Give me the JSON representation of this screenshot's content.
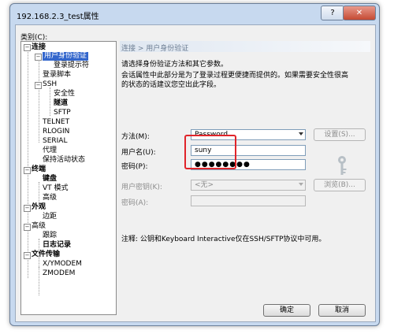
{
  "window": {
    "title": "192.168.2.3_test属性",
    "help_label": "?",
    "close_label": "✕"
  },
  "category_label": "类别(C):",
  "tree": {
    "connection": "连接",
    "auth": "用户身份验证",
    "login_prompt": "登录提示符",
    "login_script": "登录脚本",
    "ssh": "SSH",
    "security": "安全性",
    "tunnel": "隧道",
    "sftp": "SFTP",
    "telnet": "TELNET",
    "rlogin": "RLOGIN",
    "serial": "SERIAL",
    "proxy": "代理",
    "keepalive": "保持活动状态",
    "terminal": "终端",
    "keyboard": "键盘",
    "vt_mode": "VT 模式",
    "term_advanced": "高级",
    "appearance": "外观",
    "margin": "边距",
    "advanced": "高级",
    "trace": "跟踪",
    "logging": "日志记录",
    "file_transfer": "文件传输",
    "xymodem": "X/YMODEM",
    "zmodem": "ZMODEM"
  },
  "panel": {
    "header": "连接 > 用户身份验证",
    "desc1": "请选择身份验证方法和其它参数。",
    "desc2": "会话属性中此部分是为了登录过程更便捷而提供的。如果需要安全性很高",
    "desc3": "的状态的话建议您空出此字段。",
    "method_label": "方法(M):",
    "method_value": "Password",
    "settings_button": "设置(S)...",
    "username_label": "用户名(U):",
    "username_value": "suny",
    "password_label": "密码(P):",
    "password_value": "●●●●●●●●",
    "userkey_label": "用户密钥(K):",
    "userkey_value": "<无>",
    "browse_button": "浏览(B)...",
    "passphrase_label": "密码(A):",
    "note": "注释: 公钥和Keyboard Interactive仅在SSH/SFTP协议中可用。"
  },
  "footer": {
    "ok_label": "确定",
    "cancel_label": "取消"
  }
}
